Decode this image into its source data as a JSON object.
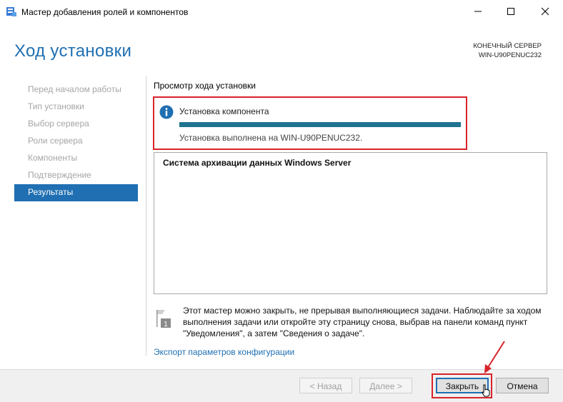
{
  "window": {
    "title": "Мастер добавления ролей и компонентов",
    "minimize_icon": "minimize-icon",
    "maximize_icon": "maximize-icon",
    "close_icon": "close-icon"
  },
  "header": {
    "title": "Ход установки",
    "server_label": "КОНЕЧНЫЙ СЕРВЕР",
    "server_name": "WIN-U90PENUC232"
  },
  "nav": {
    "items": [
      {
        "label": "Перед началом работы",
        "active": false
      },
      {
        "label": "Тип установки",
        "active": false
      },
      {
        "label": "Выбор сервера",
        "active": false
      },
      {
        "label": "Роли сервера",
        "active": false
      },
      {
        "label": "Компоненты",
        "active": false
      },
      {
        "label": "Подтверждение",
        "active": false
      },
      {
        "label": "Результаты",
        "active": true
      }
    ]
  },
  "main": {
    "section_title": "Просмотр хода установки",
    "status": {
      "heading": "Установка компонента",
      "progress": 1.0,
      "message": "Установка выполнена на WIN-U90PENUC232."
    },
    "results": [
      "Система архивации данных Windows Server"
    ],
    "note": "Этот мастер можно закрыть, не прерывая выполняющиеся задачи. Наблюдайте за ходом выполнения задачи или откройте эту страницу снова, выбрав на панели команд пункт \"Уведомления\", а затем \"Сведения о задаче\".",
    "export_link": "Экспорт параметров конфигурации"
  },
  "footer": {
    "back": "< Назад",
    "next": "Далее >",
    "close": "Закрыть",
    "cancel": "Отмена"
  },
  "colors": {
    "accent": "#1f6fb2",
    "progress": "#1f7490",
    "highlight": "#d8232a"
  }
}
